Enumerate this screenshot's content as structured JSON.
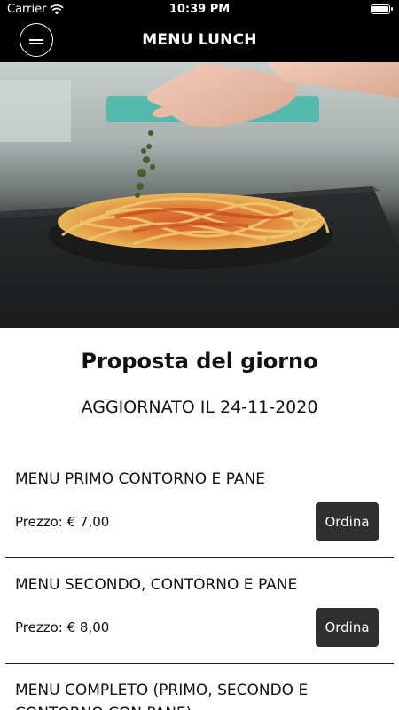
{
  "status": {
    "carrier": "Carrier",
    "time": "10:39 PM"
  },
  "header": {
    "title": "MENU LUNCH"
  },
  "section": {
    "title": "Proposta del giorno",
    "updated": "AGGIORNATO IL 24-11-2020"
  },
  "menu": [
    {
      "name": "MENU PRIMO CONTORNO E PANE",
      "price": "Prezzo: € 7,00",
      "order_label": "Ordina"
    },
    {
      "name": "MENU SECONDO, CONTORNO E PANE",
      "price": "Prezzo: € 8,00",
      "order_label": "Ordina"
    },
    {
      "name": "MENU COMPLETO (PRIMO, SECONDO E CONTORNO CON PANE)",
      "price": "",
      "order_label": ""
    }
  ],
  "colors": {
    "bar_background": "#000000",
    "button_background": "#2f2f2f"
  }
}
